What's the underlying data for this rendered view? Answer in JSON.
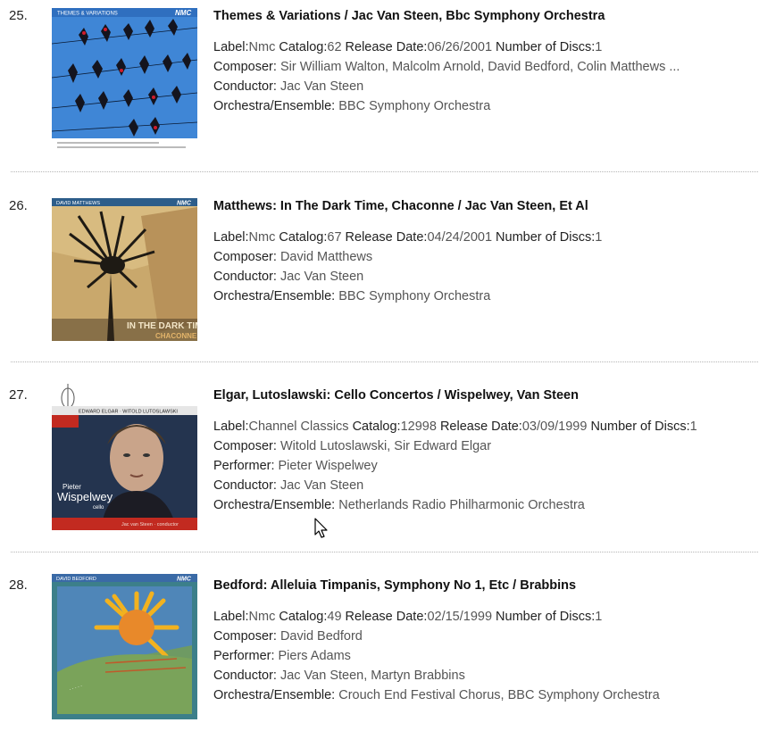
{
  "results": [
    {
      "number": "25.",
      "title": "Themes & Variations / Jac Van Steen, Bbc Symphony Orchestra",
      "label": "Nmc",
      "catalog": "62",
      "release_date": "06/26/2001",
      "discs": "1",
      "composer": "Sir William Walton, Malcolm Arnold, David Bedford, Colin Matthews ...",
      "conductor": "Jac Van Steen",
      "orchestra": "BBC Symphony Orchestra",
      "cover_text": {
        "top": "THEMES & VARIATIONS",
        "brand": "NMC"
      }
    },
    {
      "number": "26.",
      "title": "Matthews: In The Dark Time, Chaconne / Jac Van Steen, Et Al",
      "label": "Nmc",
      "catalog": "67",
      "release_date": "04/24/2001",
      "discs": "1",
      "composer": "David Matthews",
      "conductor": "Jac Van Steen",
      "orchestra": "BBC Symphony Orchestra",
      "cover_text": {
        "top": "DAVID MATTHEWS",
        "brand": "NMC",
        "line1": "IN THE DARK TIME",
        "line2": "CHACONNE"
      }
    },
    {
      "number": "27.",
      "title": "Elgar, Lutoslawski: Cello Concertos / Wispelwey, Van Steen",
      "label": "Channel Classics",
      "catalog": "12998",
      "release_date": "03/09/1999",
      "discs": "1",
      "composer": "Witold Lutoslawski, Sir Edward Elgar",
      "performer": "Pieter Wispelwey",
      "conductor": "Jac Van Steen",
      "orchestra": "Netherlands Radio Philharmonic Orchestra",
      "cover_text": {
        "top": "EDWARD ELGAR · WITOLD LUTOSLAWSKI",
        "name1": "Pieter",
        "name2": "Wispelwey",
        "role": "cello",
        "foot": "Jac van Steen · conductor"
      }
    },
    {
      "number": "28.",
      "title": "Bedford: Alleluia Timpanis, Symphony No 1, Etc / Brabbins",
      "label": "Nmc",
      "catalog": "49",
      "release_date": "02/15/1999",
      "discs": "1",
      "composer": "David Bedford",
      "performer": "Piers Adams",
      "conductor": "Jac Van Steen, Martyn Brabbins",
      "orchestra": "Crouch End Festival Chorus, BBC Symphony Orchestra",
      "cover_text": {
        "top": "DAVID BEDFORD",
        "brand": "NMC"
      }
    }
  ],
  "field_labels": {
    "label": "Label:",
    "catalog": "Catalog:",
    "release_date": "Release Date:",
    "discs": "Number of Discs:",
    "composer": "Composer: ",
    "performer": "Performer: ",
    "conductor": "Conductor: ",
    "orchestra": "Orchestra/Ensemble: "
  },
  "colors": {
    "value_text": "#555555",
    "title_text": "#111111",
    "separator": "#b5b5b5"
  }
}
